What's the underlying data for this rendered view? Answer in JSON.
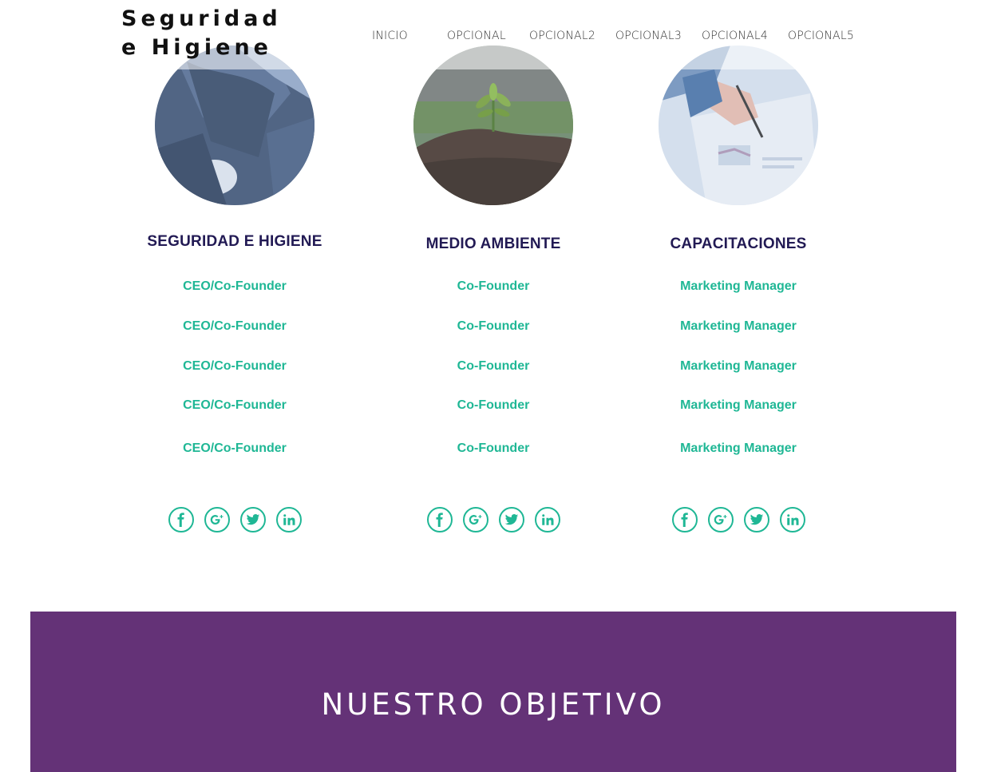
{
  "header": {
    "brand_line1": "Seguridad",
    "brand_line2": "e Higiene",
    "nav": [
      {
        "label": "INICIO"
      },
      {
        "label": "OPCIONAL"
      },
      {
        "label": "OPCIONAL2"
      },
      {
        "label": "OPCIONAL3"
      },
      {
        "label": "OPCIONAL4"
      },
      {
        "label": "OPCIONAL5"
      }
    ]
  },
  "columns": [
    {
      "title": "SEGURIDAD E HIGIENE",
      "roles": [
        "CEO/Co-Founder",
        "CEO/Co-Founder",
        "CEO/Co-Founder",
        "CEO/Co-Founder",
        "CEO/Co-Founder"
      ],
      "image": "worker-protective-gear-photo"
    },
    {
      "title": "MEDIO AMBIENTE",
      "roles": [
        "Co-Founder",
        "Co-Founder",
        "Co-Founder",
        "Co-Founder",
        "Co-Founder"
      ],
      "image": "plant-sprout-soil-photo"
    },
    {
      "title": "CAPACITACIONES",
      "roles": [
        "Marketing Manager",
        "Marketing Manager",
        "Marketing Manager",
        "Marketing Manager",
        "Marketing Manager"
      ],
      "image": "hand-writing-charts-photo"
    }
  ],
  "social_icons": [
    "facebook-icon",
    "google-plus-icon",
    "twitter-icon",
    "linkedin-icon"
  ],
  "banner": {
    "title": "NUESTRO OBJETIVO"
  },
  "colors": {
    "accent_teal": "#1fb795",
    "title_navy": "#221a54",
    "banner_purple": "#643277"
  }
}
